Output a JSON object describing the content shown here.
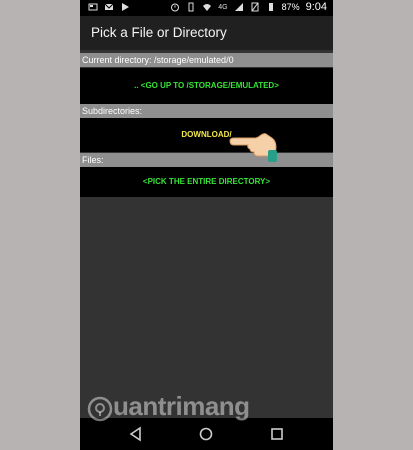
{
  "status_bar": {
    "battery": "87%",
    "network": "4G",
    "time": "9:04"
  },
  "title": "Pick a File or Directory",
  "current_directory_label": "Current directory: /storage/emulated/0",
  "go_up_button": ".. <GO UP TO /STORAGE/EMULATED>",
  "subdirectories_label": "Subdirectories:",
  "subdirectories": [
    {
      "label": "DOWNLOAD/"
    }
  ],
  "files_label": "Files:",
  "pick_entire_button": "<PICK THE ENTIRE DIRECTORY>",
  "watermark": "uantrimang",
  "colors": {
    "accent_green": "#37e337",
    "download_yellow": "#f2e94a"
  }
}
